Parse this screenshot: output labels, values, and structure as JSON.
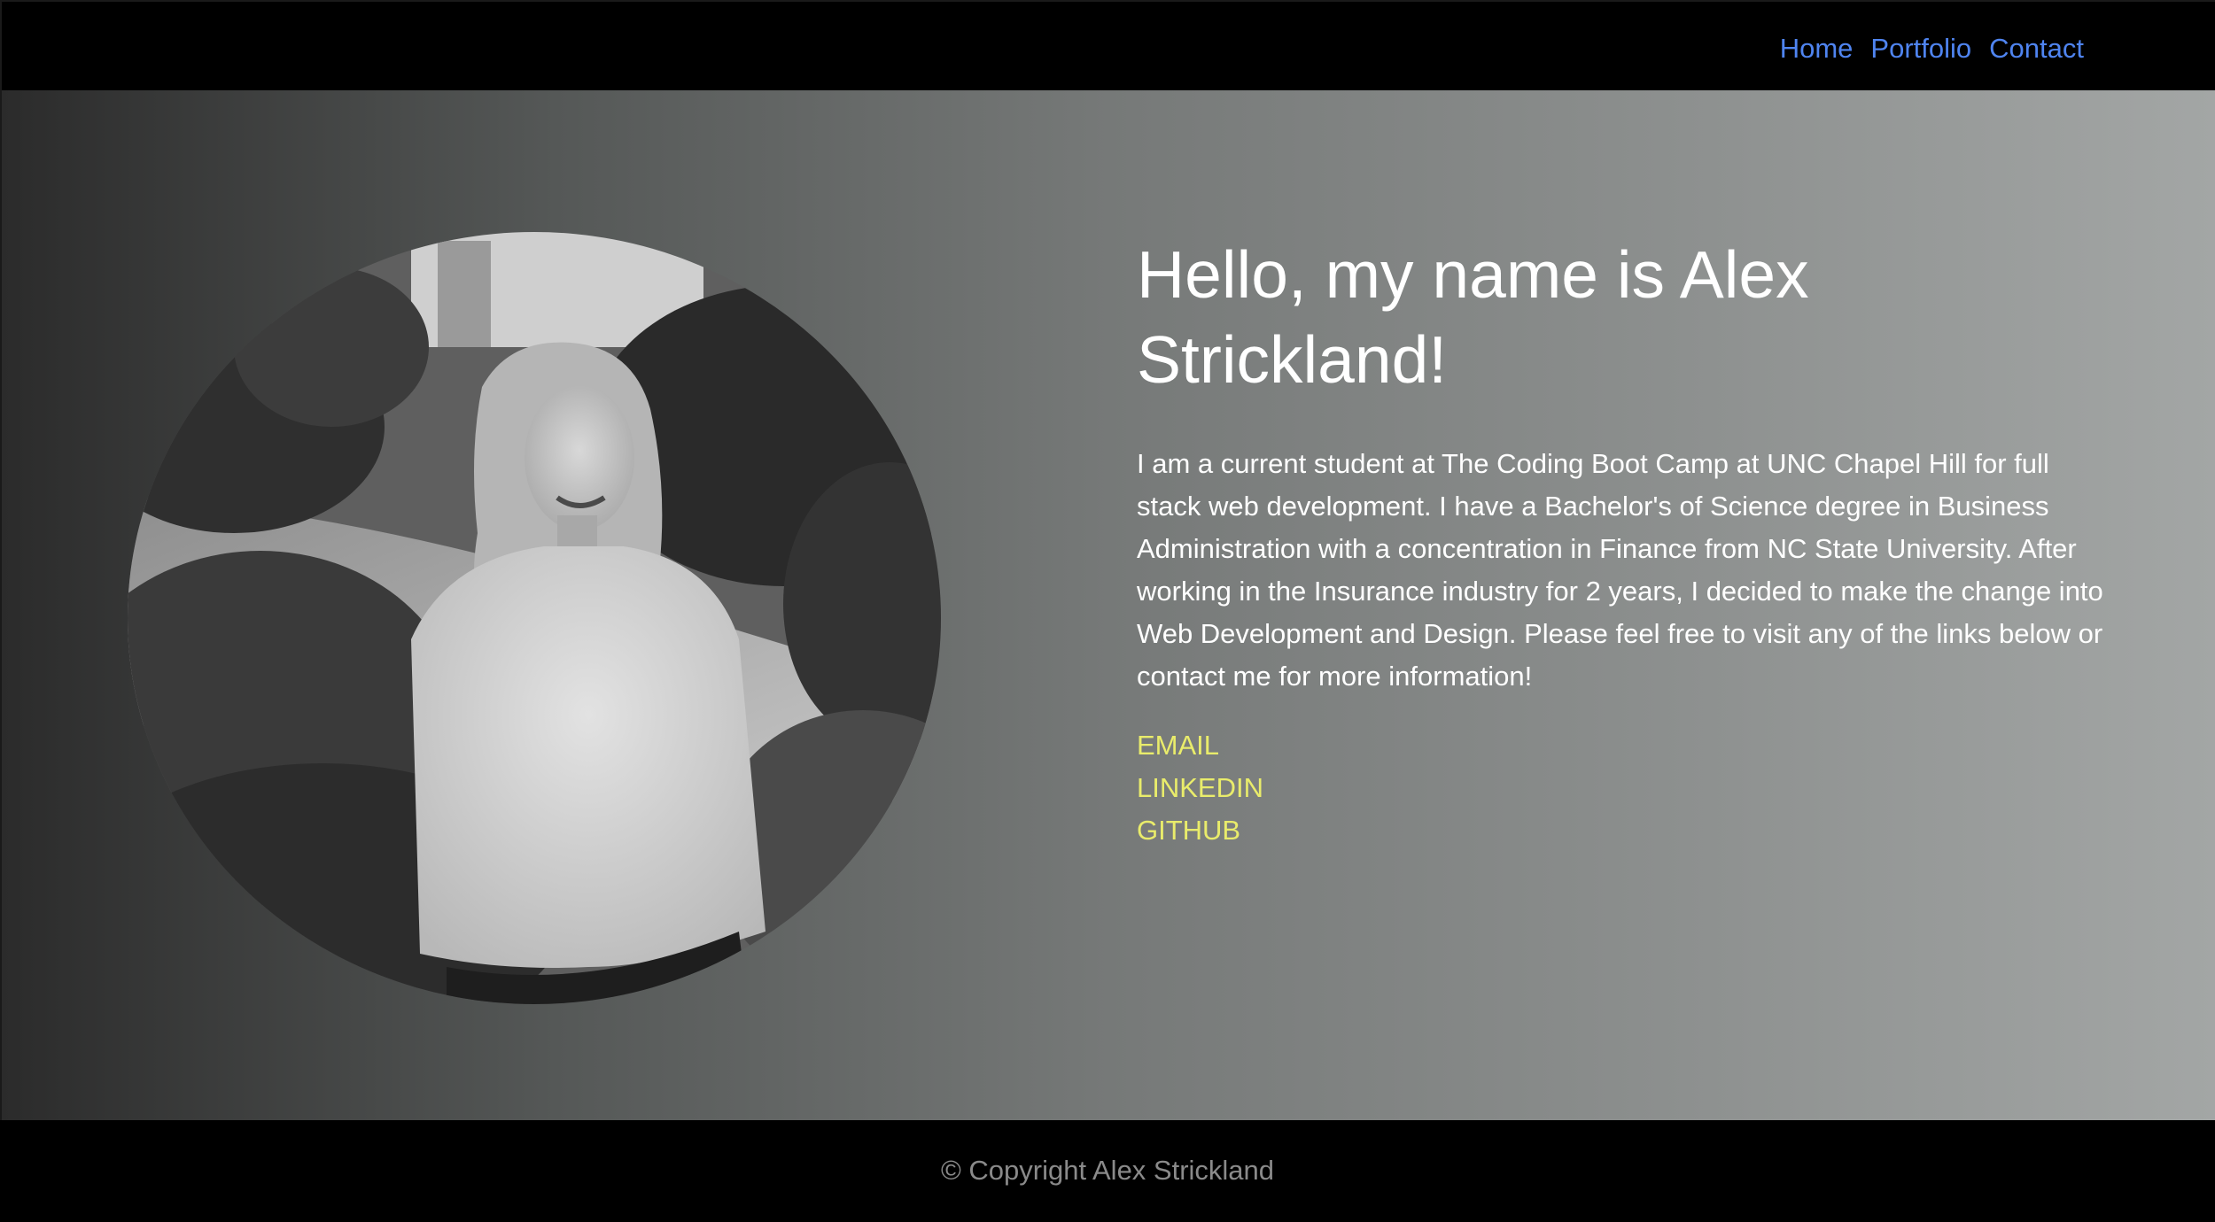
{
  "nav": {
    "links": [
      {
        "label": "Home"
      },
      {
        "label": "Portfolio"
      },
      {
        "label": "Contact"
      }
    ]
  },
  "hero": {
    "headline": "Hello, my name is Alex Strickland!",
    "bio": "I am a current student at The Coding Boot Camp at UNC Chapel Hill for full stack web development. I have a Bachelor's of Science degree in Business Administration with a concentration in Finance from NC State University. After working in the Insurance industry for 2 years, I decided to make the change into Web Development and Design. Please feel free to visit any of the links below or contact me for more information!",
    "links": [
      {
        "label": "EMAIL"
      },
      {
        "label": "LINKEDIN"
      },
      {
        "label": "GITHUB"
      }
    ]
  },
  "footer": {
    "copyright": "© Copyright Alex Strickland"
  },
  "colors": {
    "nav_link": "#4f84f0",
    "accent_link": "#e9ec6b",
    "footer_text": "#8a8a8a",
    "bar_background": "#000000"
  }
}
